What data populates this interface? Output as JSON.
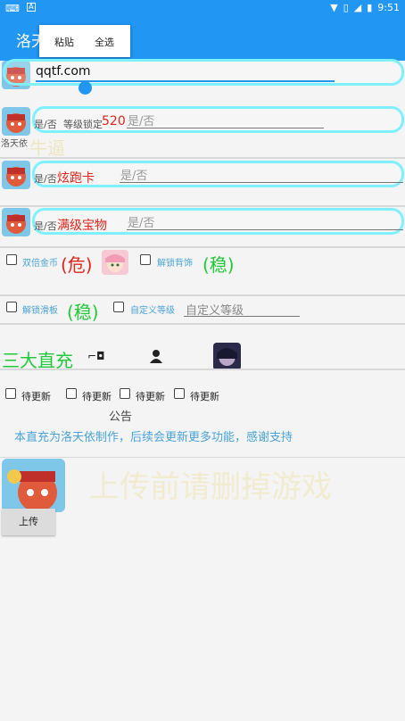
{
  "status": {
    "time": "9:51"
  },
  "app": {
    "title": "洛天"
  },
  "context_menu": {
    "paste": "粘贴",
    "select_all": "全选"
  },
  "url_field": {
    "value": "qqtf.com"
  },
  "row1": {
    "yes_no": "是/否",
    "level_lock": "等级锁定",
    "number": "520",
    "placeholder": "是/否",
    "side_label": "洛天依",
    "overlay": "牛逼"
  },
  "row2": {
    "yes_no": "是/否",
    "item": "炫跑卡",
    "placeholder": "是/否"
  },
  "row3": {
    "yes_no": "是/否",
    "item": "满级宝物",
    "placeholder": "是/否"
  },
  "row4": {
    "double_coin": "双倍金币",
    "danger": "(危)",
    "unlock_backpack": "解锁背饰",
    "stable": "(稳)"
  },
  "row5": {
    "unlock_board": "解锁滑板",
    "stable": "(稳)",
    "custom_level": "自定义等级",
    "custom_level_placeholder": "自定义等级"
  },
  "section": {
    "title": "三大直充"
  },
  "pending": {
    "items": [
      "待更新",
      "待更新",
      "待更新",
      "待更新"
    ]
  },
  "notice": {
    "title": "公告",
    "text": "本直充为洛天依制作，后续会更新更多功能，感谢支持"
  },
  "upload": {
    "warning": "上传前请删掉游戏",
    "button": "上传"
  },
  "colors": {
    "primary": "#2196f3",
    "outline": "#7ff0ff",
    "red": "#e0251b",
    "green": "#22c93a",
    "notice_blue": "#4aa3d8",
    "faded_warning": "#f1ecd0"
  }
}
